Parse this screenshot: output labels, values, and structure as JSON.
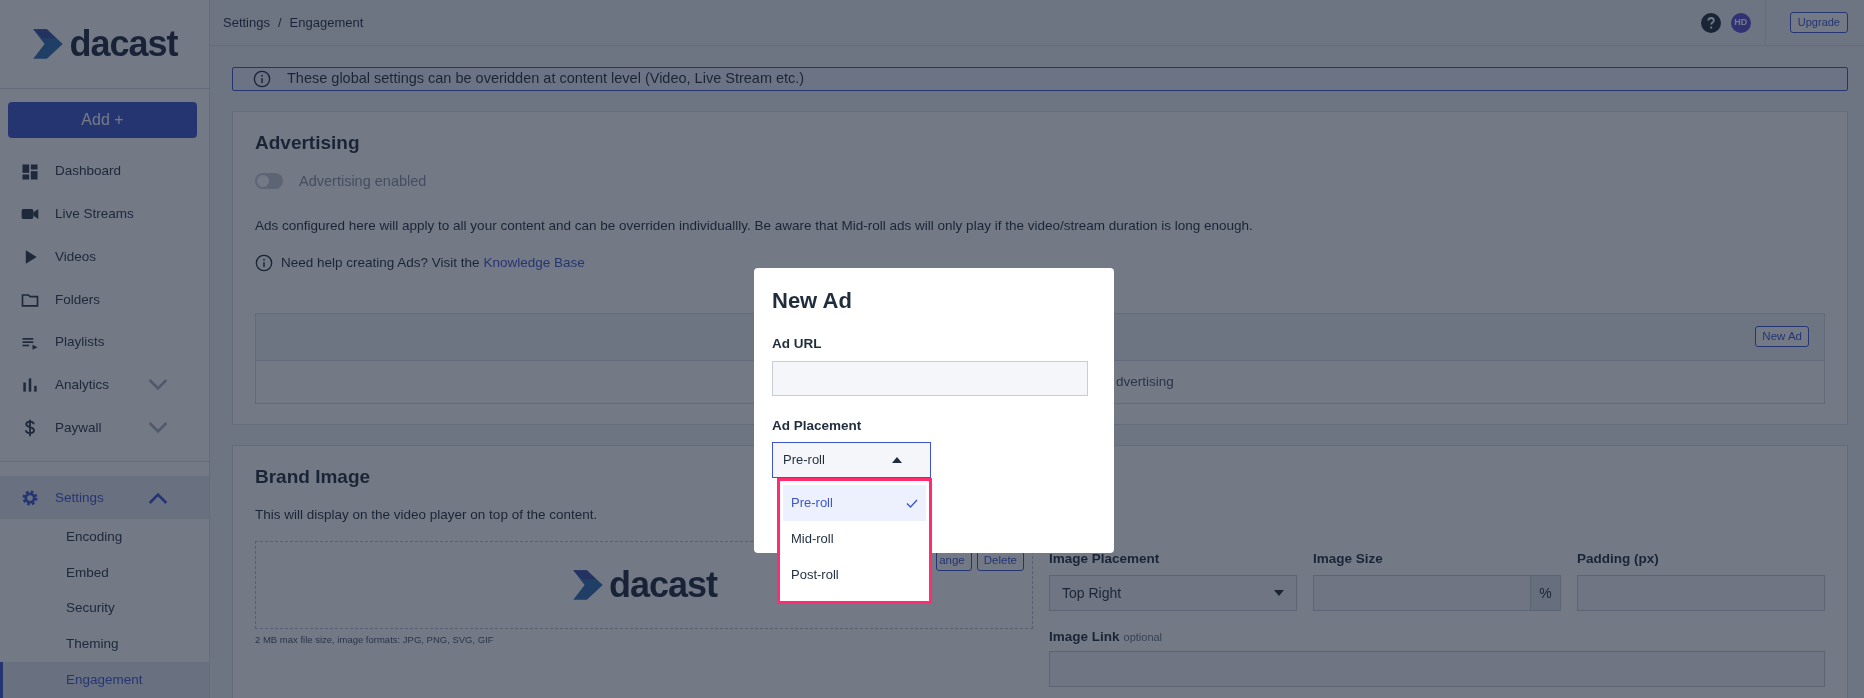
{
  "sidebar": {
    "logo": "dacast",
    "add_button": "Add +",
    "items": [
      {
        "label": "Dashboard",
        "selected": false
      },
      {
        "label": "Live Streams",
        "selected": false
      },
      {
        "label": "Videos",
        "selected": false
      },
      {
        "label": "Folders",
        "selected": false
      },
      {
        "label": "Playlists",
        "selected": false
      },
      {
        "label": "Analytics",
        "selected": false,
        "expanded": false
      },
      {
        "label": "Paywall",
        "selected": false,
        "expanded": false
      },
      {
        "label": "Settings",
        "selected": true,
        "expanded": true,
        "children": [
          {
            "label": "Encoding",
            "selected": false
          },
          {
            "label": "Embed",
            "selected": false
          },
          {
            "label": "Security",
            "selected": false
          },
          {
            "label": "Theming",
            "selected": false
          },
          {
            "label": "Engagement",
            "selected": true
          }
        ]
      }
    ]
  },
  "top_bar": {
    "breadcrumb": [
      "Settings",
      "Engagement"
    ],
    "separator": "/",
    "avatar": "HD",
    "upgrade_button": "Upgrade"
  },
  "banner": {
    "text": "These global settings can be overidden at content level (Video, Live Stream etc.)"
  },
  "advertising": {
    "title": "Advertising",
    "toggle": {
      "label": "Advertising enabled",
      "on": false
    },
    "description": "Ads configured here will apply to all your content and can be overriden individuallly. Be aware that Mid-roll ads will only play if the video/stream duration is long enough.",
    "help": {
      "text": "Need help creating Ads? Visit the",
      "link": "Knowledge Base"
    },
    "table": {
      "new_ad_button": "New Ad",
      "empty_text": "dvertising"
    }
  },
  "brand_image": {
    "title": "Brand Image",
    "description": "This will display on the video player on top of the content.",
    "logo": "dacast",
    "buttons": [
      "ange",
      "Delete"
    ],
    "note": "2 MB max file size, image formats: JPG, PNG, SVG, GIF",
    "image_placement": {
      "label": "Image Placement",
      "value": "Top Right"
    },
    "image_size": {
      "label": "Image Size",
      "suffix": "%"
    },
    "padding": {
      "label": "Padding (px)"
    },
    "image_link": {
      "label": "Image Link",
      "hint": "optional"
    }
  },
  "modal": {
    "title": "New Ad",
    "ad_url_label": "Ad URL",
    "placement_label": "Ad Placement",
    "placement_value": "Pre-roll",
    "expanded": true,
    "options": [
      {
        "label": "Pre-roll",
        "selected": true
      },
      {
        "label": "Mid-roll",
        "selected": false
      },
      {
        "label": "Post-roll",
        "selected": false
      }
    ]
  }
}
